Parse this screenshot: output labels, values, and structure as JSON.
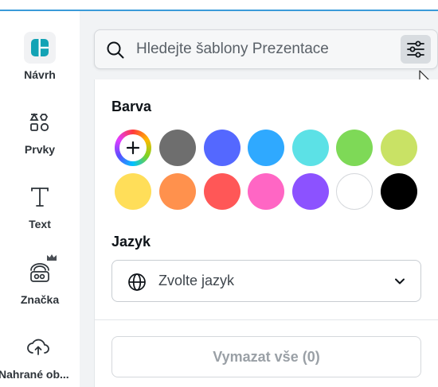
{
  "sidebar": {
    "items": [
      {
        "label": "Návrh",
        "icon": "design-icon"
      },
      {
        "label": "Prvky",
        "icon": "shapes-icon"
      },
      {
        "label": "Text",
        "icon": "text-icon"
      },
      {
        "label": "Značka",
        "icon": "brand-icon"
      },
      {
        "label": "Nahrané ob...",
        "icon": "upload-cloud-icon"
      }
    ]
  },
  "search": {
    "placeholder": "Hledejte šablony Prezentace"
  },
  "filters": {
    "color_title": "Barva",
    "colors": [
      "rainbow",
      "#6e6e6e",
      "#5468ff",
      "#2fa9ff",
      "#5ce1e6",
      "#7ed957",
      "#c9e265",
      "#ffde59",
      "#ff914d",
      "#ff5757",
      "#ff66c4",
      "#8c52ff",
      "#ffffff",
      "#000000"
    ],
    "language_title": "Jazyk",
    "language_placeholder": "Zvolte jazyk",
    "clear_label": "Vymazat vše (0)"
  }
}
